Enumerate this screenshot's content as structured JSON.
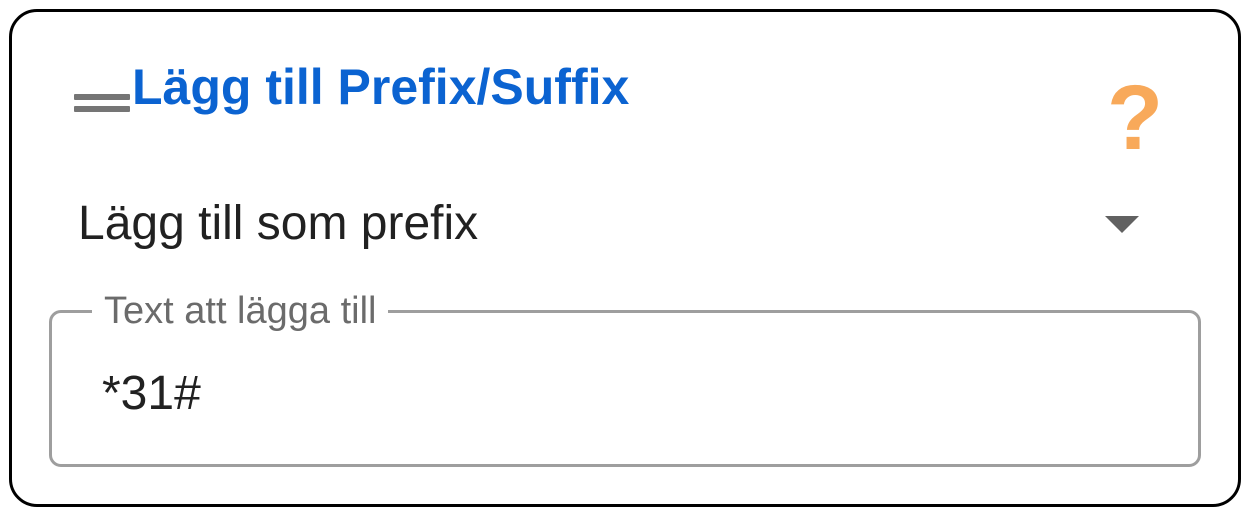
{
  "block": {
    "title": "Lägg till Prefix/Suffix",
    "help_icon": "?",
    "handle_icon": "drag-handle-icon",
    "colors": {
      "title": "#0b63d1",
      "help": "#f8a95a",
      "border": "#000000"
    }
  },
  "mode_select": {
    "selected": "Lägg till som prefix"
  },
  "text_field": {
    "label": "Text att lägga till",
    "value": "*31#"
  }
}
